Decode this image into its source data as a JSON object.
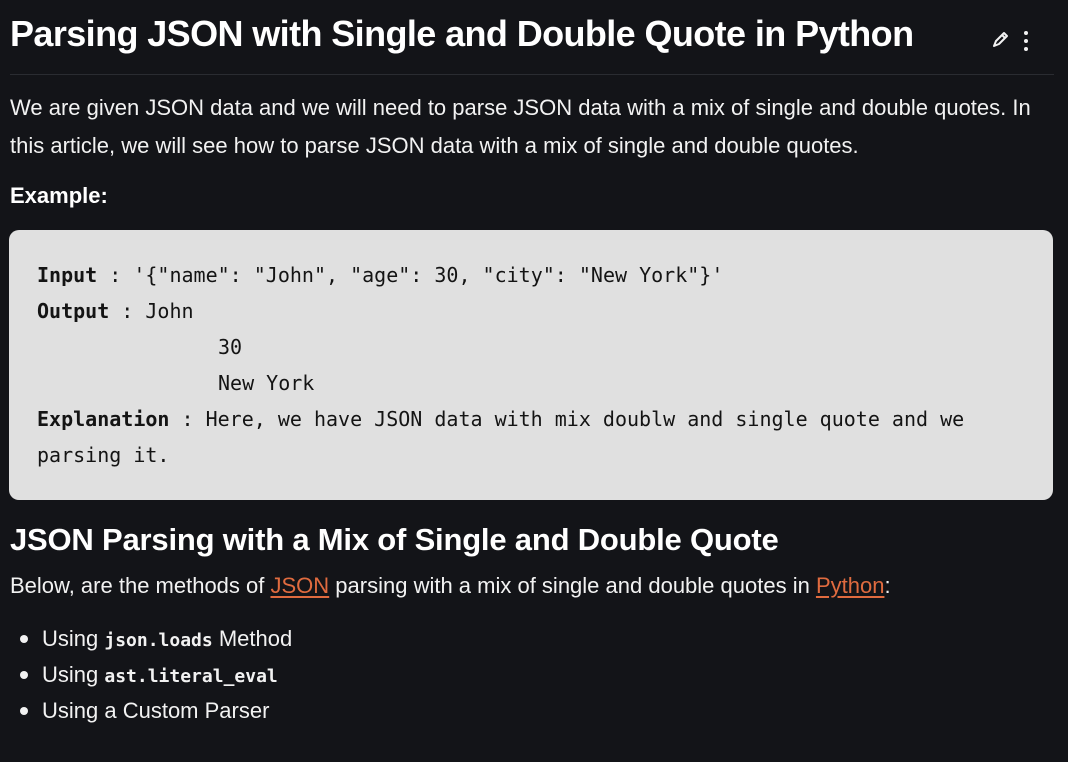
{
  "article": {
    "title": "Parsing JSON with Single and Double Quote in Python",
    "intro": "We are given JSON data and we will need to parse JSON data with a mix of single and double quotes. In this article, we will see how to parse JSON data with a mix of single and double quotes.",
    "example_label": "Example:"
  },
  "actions": {
    "edit_icon": "pencil-icon",
    "more_icon": "vertical-ellipsis-icon"
  },
  "example": {
    "input_key": "Input",
    "input_separator": " : ",
    "input_value": "'{\"name\": \"John\", \"age\": 30, \"city\": \"New York\"}'",
    "output_key": "Output",
    "output_separator": " : ",
    "output_values": [
      "John",
      "30",
      "New York"
    ],
    "explanation_key": "Explanation",
    "explanation_separator": " : ",
    "explanation_line_1": "Here, we have JSON data with mix doublw and single quote and we",
    "explanation_line_2": "parsing it."
  },
  "section": {
    "heading": "JSON Parsing with a Mix of Single and Double Quote",
    "intro_before": "Below, are the methods of ",
    "json_link": "JSON",
    "intro_middle": " parsing with a mix of single and double quotes in ",
    "python_link": "Python",
    "intro_after": ":"
  },
  "methods": [
    {
      "prefix": "Using ",
      "code": "json.loads",
      "suffix": " Method"
    },
    {
      "prefix": "Using ",
      "code": "ast.literal_eval",
      "suffix": ""
    },
    {
      "prefix": "Using a Custom Parser",
      "code": "",
      "suffix": ""
    }
  ],
  "colors": {
    "background": "#131418",
    "text": "#f2f2f2",
    "code_background": "#e0e0e0",
    "link": "#e06b3f"
  }
}
